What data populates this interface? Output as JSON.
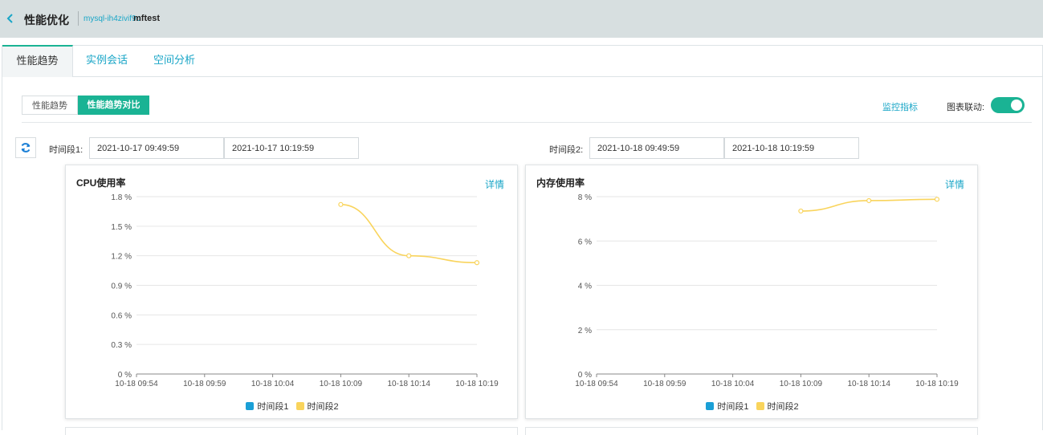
{
  "header": {
    "title": "性能优化",
    "instance_id": "mysql-ih4zivif9c",
    "instance_name": "mftest"
  },
  "tabs": [
    {
      "label": "性能趋势",
      "active": true
    },
    {
      "label": "实例会话",
      "active": false
    },
    {
      "label": "空间分析",
      "active": false
    }
  ],
  "sub_tabs": [
    {
      "label": "性能趋势",
      "active": false
    },
    {
      "label": "性能趋势对比",
      "active": true
    }
  ],
  "toolbar": {
    "monitor_link": "监控指标",
    "chart_link_label": "图表联动:",
    "chart_link_on": true
  },
  "range1": {
    "label": "时间段1:",
    "start": "2021-10-17 09:49:59",
    "end": "2021-10-17 10:19:59"
  },
  "range2": {
    "label": "时间段2:",
    "start": "2021-10-18 09:49:59",
    "end": "2021-10-18 10:19:59"
  },
  "colors": {
    "accent": "#1ab394",
    "link": "#1aa6c7",
    "series1": "#1a9fd6",
    "series2": "#f9d45c"
  },
  "chart_data": [
    {
      "type": "line",
      "title": "CPU使用率",
      "detail_label": "详情",
      "categories": [
        "10-18 09:54",
        "10-18 09:59",
        "10-18 10:04",
        "10-18 10:09",
        "10-18 10:14",
        "10-18 10:19"
      ],
      "y_ticks": [
        "1.8 %",
        "1.5 %",
        "1.2 %",
        "0.9 %",
        "0.6 %",
        "0.3 %",
        "0 %"
      ],
      "ylim": [
        0,
        1.8
      ],
      "grid": true,
      "legend_position": "bottom",
      "series": [
        {
          "name": "时间段1",
          "values": [
            null,
            null,
            null,
            null,
            null,
            null
          ]
        },
        {
          "name": "时间段2",
          "values": [
            null,
            null,
            null,
            1.72,
            1.2,
            1.13
          ]
        }
      ]
    },
    {
      "type": "line",
      "title": "内存使用率",
      "detail_label": "详情",
      "categories": [
        "10-18 09:54",
        "10-18 09:59",
        "10-18 10:04",
        "10-18 10:09",
        "10-18 10:14",
        "10-18 10:19"
      ],
      "y_ticks": [
        "8 %",
        "6 %",
        "4 %",
        "2 %",
        "0 %"
      ],
      "ylim": [
        0,
        8
      ],
      "grid": true,
      "legend_position": "bottom",
      "series": [
        {
          "name": "时间段1",
          "values": [
            null,
            null,
            null,
            null,
            null,
            null
          ]
        },
        {
          "name": "时间段2",
          "values": [
            null,
            null,
            null,
            7.35,
            7.82,
            7.88
          ]
        }
      ]
    }
  ]
}
